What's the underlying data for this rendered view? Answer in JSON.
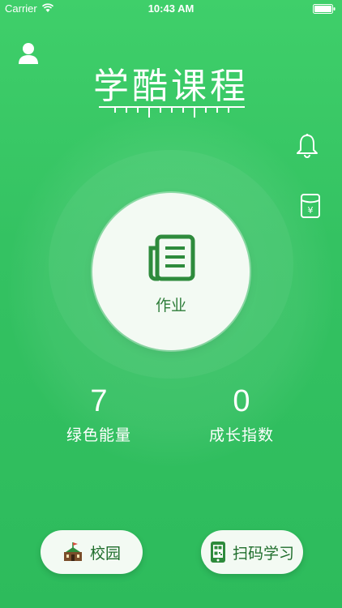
{
  "status_bar": {
    "carrier": "Carrier",
    "time": "10:43 AM"
  },
  "header": {
    "title": "学酷课程"
  },
  "main": {
    "homework_label": "作业"
  },
  "stats": {
    "green_energy_value": "7",
    "green_energy_label": "绿色能量",
    "growth_index_value": "0",
    "growth_index_label": "成长指数"
  },
  "bottom": {
    "campus_label": "校园",
    "scan_label": "扫码学习"
  },
  "colors": {
    "background": "#34c262",
    "accent_dark": "#1f6e2c",
    "circle_fill": "#f3faf3"
  },
  "icons": [
    "user-icon",
    "bell-icon",
    "wallet-icon",
    "homework-icon",
    "campus-icon",
    "scan-phone-icon",
    "wifi-icon",
    "battery-icon"
  ]
}
